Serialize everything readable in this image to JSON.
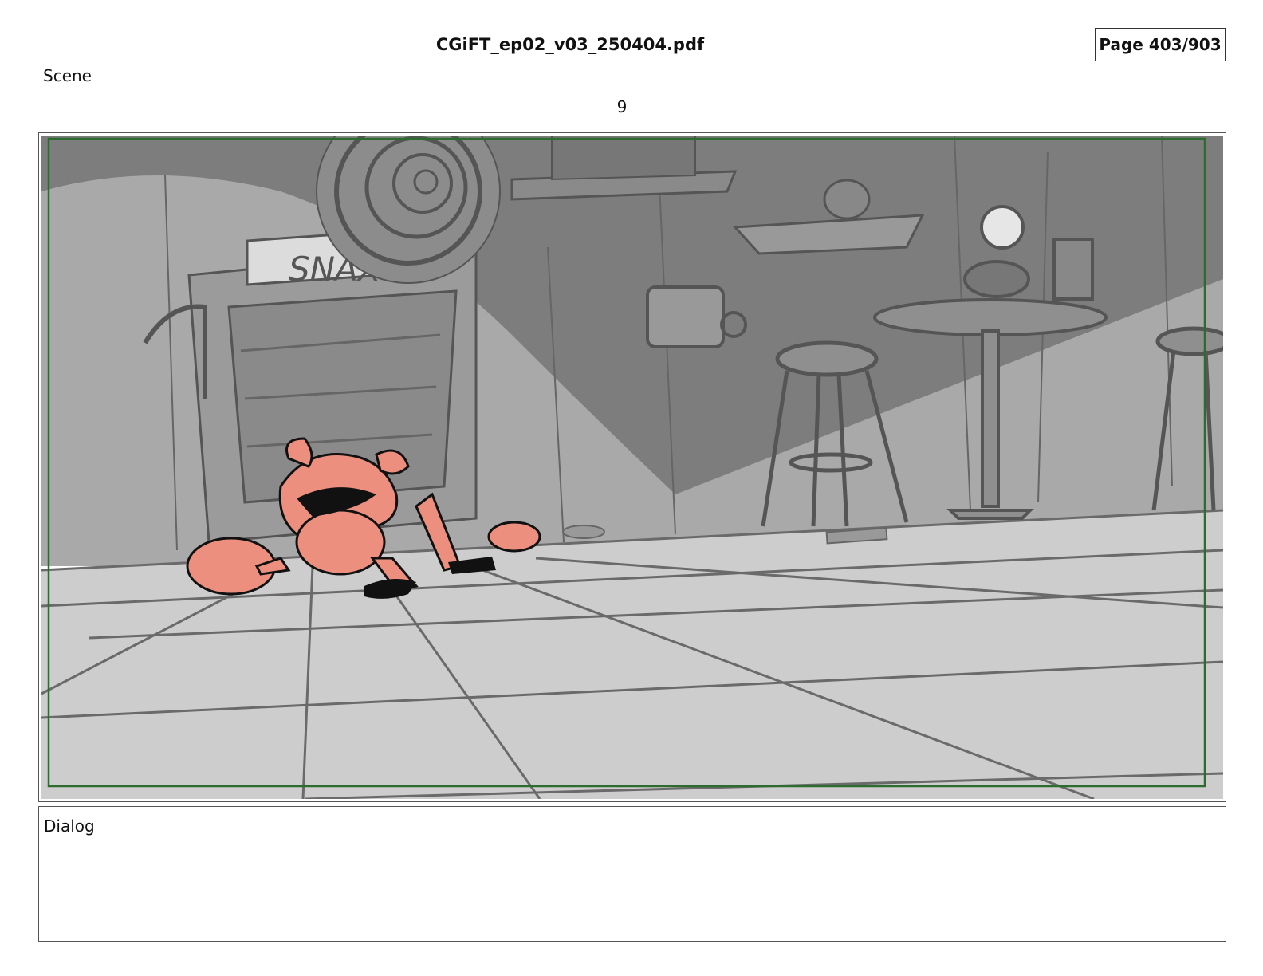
{
  "header": {
    "file_name": "CGiFT_ep02_v03_250404.pdf",
    "page_label": "Page 403/903"
  },
  "scene": {
    "label": "Scene",
    "number": "9"
  },
  "panel": {
    "sign_text": "SNAX",
    "safe_frame_color": "#2e6b2e",
    "character_color": "#ec8f7e"
  },
  "dialog": {
    "label": "Dialog",
    "text": ""
  }
}
